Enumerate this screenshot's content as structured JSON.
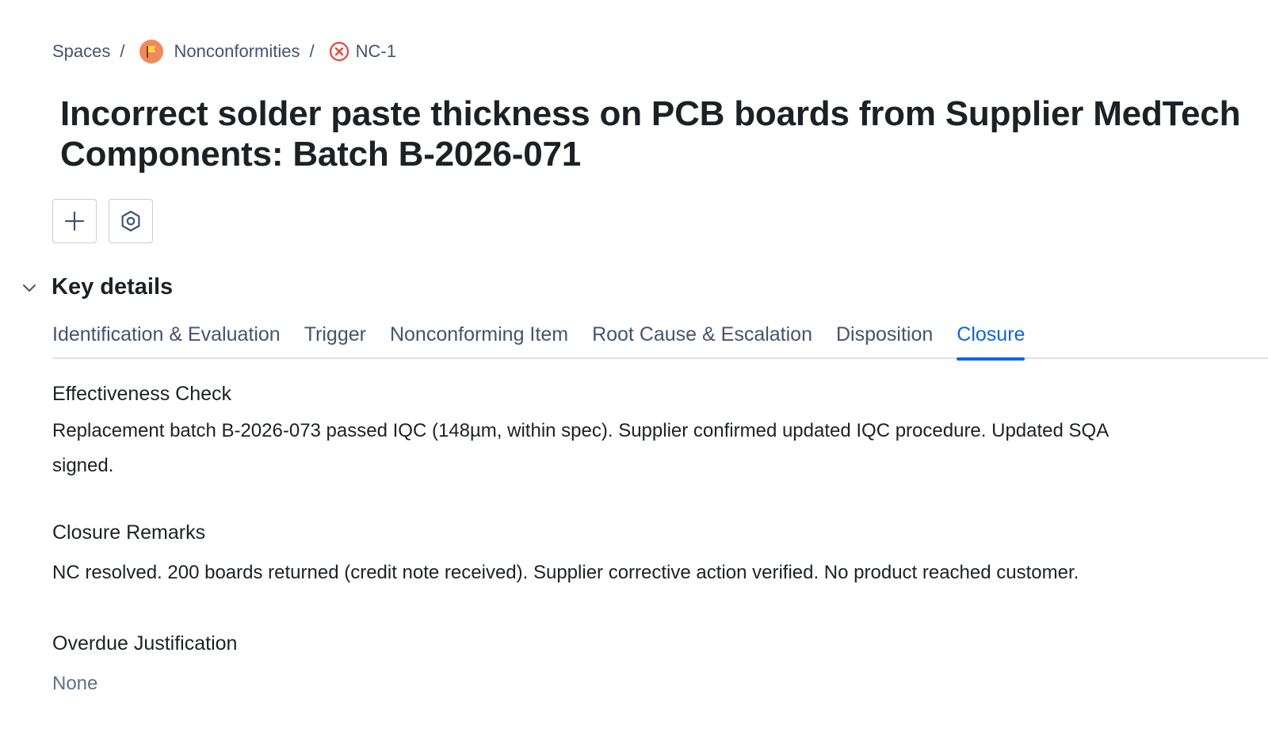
{
  "breadcrumb": {
    "spaces": "Spaces",
    "separator": "/",
    "project": "Nonconformities",
    "issue_key": "NC-1",
    "project_icon": "flag-icon",
    "issue_icon": "circle-x-icon",
    "project_icon_color": "#f08a5d",
    "issue_icon_color": "#e2483d"
  },
  "title_lines": [
    "Incorrect solder paste thickness on PCB boards from Supplier MedTech",
    "Components: Batch B-2026-071"
  ],
  "actions": {
    "add_icon": "plus-icon",
    "settings_icon": "hexagon-gear-icon"
  },
  "key_details": {
    "title": "Key details",
    "toggle_icon": "chevron-down-icon",
    "tabs": [
      {
        "label": "Identification & Evaluation",
        "active": false
      },
      {
        "label": "Trigger",
        "active": false
      },
      {
        "label": "Nonconforming Item",
        "active": false
      },
      {
        "label": "Root Cause & Escalation",
        "active": false
      },
      {
        "label": "Disposition",
        "active": false
      },
      {
        "label": "Closure",
        "active": true
      }
    ],
    "accent_color": "#0c66e4"
  },
  "fields": {
    "effectiveness_check": {
      "label": "Effectiveness Check",
      "value_lines": [
        "Replacement batch B-2026-073 passed IQC (148µm, within spec). Supplier confirmed updated IQC procedure. Updated SQA",
        "signed."
      ]
    },
    "closure_remarks": {
      "label": "Closure Remarks",
      "value": "NC resolved. 200 boards returned (credit note received). Supplier corrective action verified. No product reached customer."
    },
    "overdue_justification": {
      "label": "Overdue Justification",
      "value": "None"
    }
  }
}
